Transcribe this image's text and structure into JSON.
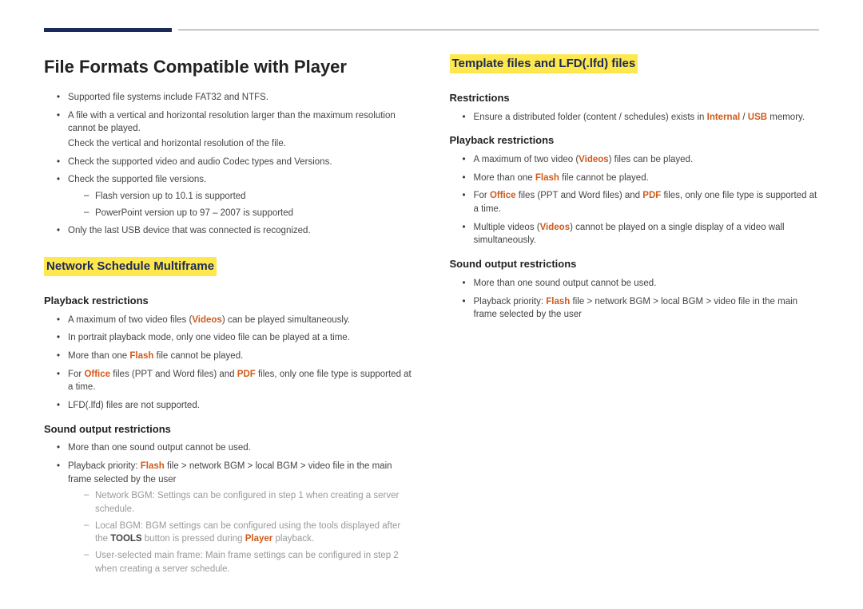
{
  "left": {
    "title": "File Formats Compatible with Player",
    "intro": {
      "b1": "Supported file systems include FAT32 and NTFS.",
      "b2": "A file with a vertical and horizontal resolution larger than the maximum resolution cannot be played.",
      "b2note": "Check the vertical and horizontal resolution of the file.",
      "b3": "Check the supported video and audio Codec types and Versions.",
      "b4": "Check the supported file versions.",
      "b4d1": "Flash version up to 10.1 is supported",
      "b4d2": "PowerPoint version up to 97 – 2007 is supported",
      "b5": "Only the last USB device that was connected is recognized."
    },
    "h2a": "Network Schedule Multiframe",
    "pb_title": "Playback restrictions",
    "pb": {
      "b1a": "A maximum of two video files (",
      "b1o": "Videos",
      "b1b": ") can be played simultaneously.",
      "b2": "In portrait playback mode, only one video file can be played at a time.",
      "b3a": "More than one ",
      "b3o": "Flash",
      "b3b": " file cannot be played.",
      "b4a": "For ",
      "b4o1": "Office",
      "b4b": " files (PPT and Word files) and ",
      "b4o2": "PDF",
      "b4c": " files, only one file type is supported at a time.",
      "b5": "LFD(.lfd) files are not supported."
    },
    "so_title": "Sound output restrictions",
    "so": {
      "b1": "More than one sound output cannot be used.",
      "b2a": "Playback priority: ",
      "b2o": "Flash",
      "b2b": " file > network BGM > local BGM > video file in the main frame selected by the user",
      "d1": "Network BGM: Settings can be configured in step 1 when creating a server schedule.",
      "d2a": "Local BGM: BGM settings can be configured using the tools displayed after the ",
      "d2bold": "TOOLS",
      "d2b": " button is pressed during ",
      "d2o": "Player",
      "d2c": " playback.",
      "d3": "User-selected main frame: Main frame settings can be configured in step 2 when creating a server schedule."
    }
  },
  "right": {
    "h2": "Template files and LFD(.lfd) files",
    "r_title": "Restrictions",
    "r": {
      "b1a": "Ensure a distributed folder (content / schedules) exists in ",
      "b1o1": "Internal",
      "b1s": " / ",
      "b1o2": "USB",
      "b1b": " memory."
    },
    "pb_title": "Playback restrictions",
    "pb": {
      "b1a": "A maximum of two video (",
      "b1o": "Videos",
      "b1b": ") files can be played.",
      "b2a": "More than one ",
      "b2o": "Flash",
      "b2b": " file cannot be played.",
      "b3a": "For ",
      "b3o1": "Office",
      "b3b": " files (PPT and Word files) and ",
      "b3o2": "PDF",
      "b3c": " files, only one file type is supported at a time.",
      "b4a": "Multiple videos (",
      "b4o": "Videos",
      "b4b": ") cannot be played on a single display of a video wall simultaneously."
    },
    "so_title": "Sound output restrictions",
    "so": {
      "b1": "More than one sound output cannot be used.",
      "b2a": "Playback priority: ",
      "b2o": "Flash",
      "b2b": " file > network BGM > local BGM > video file in the main frame selected by the user"
    }
  }
}
